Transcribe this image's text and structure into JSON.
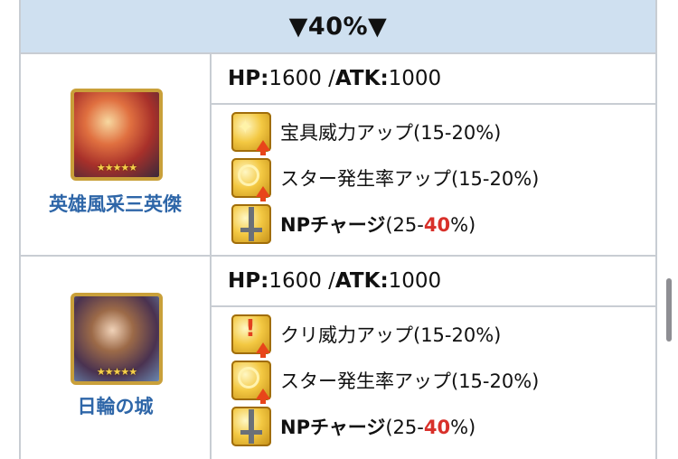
{
  "header": {
    "title": "▼40%▼"
  },
  "rows": [
    {
      "name": "英雄風采三英傑",
      "stars": "★★★★★",
      "stats": {
        "hp_label": "HP:",
        "hp_value": "1600",
        "sep": " /",
        "atk_label": "ATK:",
        "atk_value": "1000"
      },
      "skills": [
        {
          "icon": "np-damage-up-icon",
          "text": "宝具威力アップ(15-20%)"
        },
        {
          "icon": "star-gen-up-icon",
          "text": "スター発生率アップ(15-20%)"
        },
        {
          "icon": "np-charge-icon",
          "label": "NPチャージ",
          "pre": "(25-",
          "hi": "40",
          "post": "%)"
        }
      ]
    },
    {
      "name": "日輪の城",
      "stars": "★★★★★",
      "stats": {
        "hp_label": "HP:",
        "hp_value": "1600",
        "sep": " /",
        "atk_label": "ATK:",
        "atk_value": "1000"
      },
      "skills": [
        {
          "icon": "crit-damage-up-icon",
          "text": "クリ威力アップ(15-20%)"
        },
        {
          "icon": "star-gen-up-icon",
          "text": "スター発生率アップ(15-20%)"
        },
        {
          "icon": "np-charge-icon",
          "label": "NPチャージ",
          "pre": "(25-",
          "hi": "40",
          "post": "%)"
        }
      ]
    }
  ],
  "colors": {
    "header_bg": "#cfe0f0",
    "name": "#2e66a8",
    "highlight": "#d8302a",
    "border": "#c8cdd3"
  }
}
